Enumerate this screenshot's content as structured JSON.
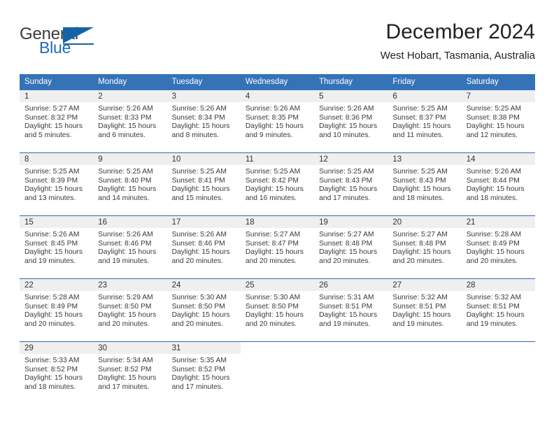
{
  "brand": {
    "name_part1": "General",
    "name_part2": "Blue",
    "flag_icon": "blue-triangle-flag-icon",
    "accent_color": "#1464a5"
  },
  "header": {
    "title": "December 2024",
    "subtitle": "West Hobart, Tasmania, Australia"
  },
  "theme": {
    "header_row_bg": "#3573b9",
    "daynum_band_bg": "#efefef",
    "row_separator": "#2e6aad",
    "text_color": "#3a3a3a"
  },
  "calendar": {
    "weekday_headers": [
      "Sunday",
      "Monday",
      "Tuesday",
      "Wednesday",
      "Thursday",
      "Friday",
      "Saturday"
    ],
    "weeks": [
      [
        {
          "day": "1",
          "sunrise": "Sunrise: 5:27 AM",
          "sunset": "Sunset: 8:32 PM",
          "daylight": "Daylight: 15 hours and 5 minutes."
        },
        {
          "day": "2",
          "sunrise": "Sunrise: 5:26 AM",
          "sunset": "Sunset: 8:33 PM",
          "daylight": "Daylight: 15 hours and 6 minutes."
        },
        {
          "day": "3",
          "sunrise": "Sunrise: 5:26 AM",
          "sunset": "Sunset: 8:34 PM",
          "daylight": "Daylight: 15 hours and 8 minutes."
        },
        {
          "day": "4",
          "sunrise": "Sunrise: 5:26 AM",
          "sunset": "Sunset: 8:35 PM",
          "daylight": "Daylight: 15 hours and 9 minutes."
        },
        {
          "day": "5",
          "sunrise": "Sunrise: 5:26 AM",
          "sunset": "Sunset: 8:36 PM",
          "daylight": "Daylight: 15 hours and 10 minutes."
        },
        {
          "day": "6",
          "sunrise": "Sunrise: 5:25 AM",
          "sunset": "Sunset: 8:37 PM",
          "daylight": "Daylight: 15 hours and 11 minutes."
        },
        {
          "day": "7",
          "sunrise": "Sunrise: 5:25 AM",
          "sunset": "Sunset: 8:38 PM",
          "daylight": "Daylight: 15 hours and 12 minutes."
        }
      ],
      [
        {
          "day": "8",
          "sunrise": "Sunrise: 5:25 AM",
          "sunset": "Sunset: 8:39 PM",
          "daylight": "Daylight: 15 hours and 13 minutes."
        },
        {
          "day": "9",
          "sunrise": "Sunrise: 5:25 AM",
          "sunset": "Sunset: 8:40 PM",
          "daylight": "Daylight: 15 hours and 14 minutes."
        },
        {
          "day": "10",
          "sunrise": "Sunrise: 5:25 AM",
          "sunset": "Sunset: 8:41 PM",
          "daylight": "Daylight: 15 hours and 15 minutes."
        },
        {
          "day": "11",
          "sunrise": "Sunrise: 5:25 AM",
          "sunset": "Sunset: 8:42 PM",
          "daylight": "Daylight: 15 hours and 16 minutes."
        },
        {
          "day": "12",
          "sunrise": "Sunrise: 5:25 AM",
          "sunset": "Sunset: 8:43 PM",
          "daylight": "Daylight: 15 hours and 17 minutes."
        },
        {
          "day": "13",
          "sunrise": "Sunrise: 5:25 AM",
          "sunset": "Sunset: 8:43 PM",
          "daylight": "Daylight: 15 hours and 18 minutes."
        },
        {
          "day": "14",
          "sunrise": "Sunrise: 5:26 AM",
          "sunset": "Sunset: 8:44 PM",
          "daylight": "Daylight: 15 hours and 18 minutes."
        }
      ],
      [
        {
          "day": "15",
          "sunrise": "Sunrise: 5:26 AM",
          "sunset": "Sunset: 8:45 PM",
          "daylight": "Daylight: 15 hours and 19 minutes."
        },
        {
          "day": "16",
          "sunrise": "Sunrise: 5:26 AM",
          "sunset": "Sunset: 8:46 PM",
          "daylight": "Daylight: 15 hours and 19 minutes."
        },
        {
          "day": "17",
          "sunrise": "Sunrise: 5:26 AM",
          "sunset": "Sunset: 8:46 PM",
          "daylight": "Daylight: 15 hours and 20 minutes."
        },
        {
          "day": "18",
          "sunrise": "Sunrise: 5:27 AM",
          "sunset": "Sunset: 8:47 PM",
          "daylight": "Daylight: 15 hours and 20 minutes."
        },
        {
          "day": "19",
          "sunrise": "Sunrise: 5:27 AM",
          "sunset": "Sunset: 8:48 PM",
          "daylight": "Daylight: 15 hours and 20 minutes."
        },
        {
          "day": "20",
          "sunrise": "Sunrise: 5:27 AM",
          "sunset": "Sunset: 8:48 PM",
          "daylight": "Daylight: 15 hours and 20 minutes."
        },
        {
          "day": "21",
          "sunrise": "Sunrise: 5:28 AM",
          "sunset": "Sunset: 8:49 PM",
          "daylight": "Daylight: 15 hours and 20 minutes."
        }
      ],
      [
        {
          "day": "22",
          "sunrise": "Sunrise: 5:28 AM",
          "sunset": "Sunset: 8:49 PM",
          "daylight": "Daylight: 15 hours and 20 minutes."
        },
        {
          "day": "23",
          "sunrise": "Sunrise: 5:29 AM",
          "sunset": "Sunset: 8:50 PM",
          "daylight": "Daylight: 15 hours and 20 minutes."
        },
        {
          "day": "24",
          "sunrise": "Sunrise: 5:30 AM",
          "sunset": "Sunset: 8:50 PM",
          "daylight": "Daylight: 15 hours and 20 minutes."
        },
        {
          "day": "25",
          "sunrise": "Sunrise: 5:30 AM",
          "sunset": "Sunset: 8:50 PM",
          "daylight": "Daylight: 15 hours and 20 minutes."
        },
        {
          "day": "26",
          "sunrise": "Sunrise: 5:31 AM",
          "sunset": "Sunset: 8:51 PM",
          "daylight": "Daylight: 15 hours and 19 minutes."
        },
        {
          "day": "27",
          "sunrise": "Sunrise: 5:32 AM",
          "sunset": "Sunset: 8:51 PM",
          "daylight": "Daylight: 15 hours and 19 minutes."
        },
        {
          "day": "28",
          "sunrise": "Sunrise: 5:32 AM",
          "sunset": "Sunset: 8:51 PM",
          "daylight": "Daylight: 15 hours and 19 minutes."
        }
      ],
      [
        {
          "day": "29",
          "sunrise": "Sunrise: 5:33 AM",
          "sunset": "Sunset: 8:52 PM",
          "daylight": "Daylight: 15 hours and 18 minutes."
        },
        {
          "day": "30",
          "sunrise": "Sunrise: 5:34 AM",
          "sunset": "Sunset: 8:52 PM",
          "daylight": "Daylight: 15 hours and 17 minutes."
        },
        {
          "day": "31",
          "sunrise": "Sunrise: 5:35 AM",
          "sunset": "Sunset: 8:52 PM",
          "daylight": "Daylight: 15 hours and 17 minutes."
        },
        {
          "day": "",
          "sunrise": "",
          "sunset": "",
          "daylight": ""
        },
        {
          "day": "",
          "sunrise": "",
          "sunset": "",
          "daylight": ""
        },
        {
          "day": "",
          "sunrise": "",
          "sunset": "",
          "daylight": ""
        },
        {
          "day": "",
          "sunrise": "",
          "sunset": "",
          "daylight": ""
        }
      ]
    ]
  }
}
